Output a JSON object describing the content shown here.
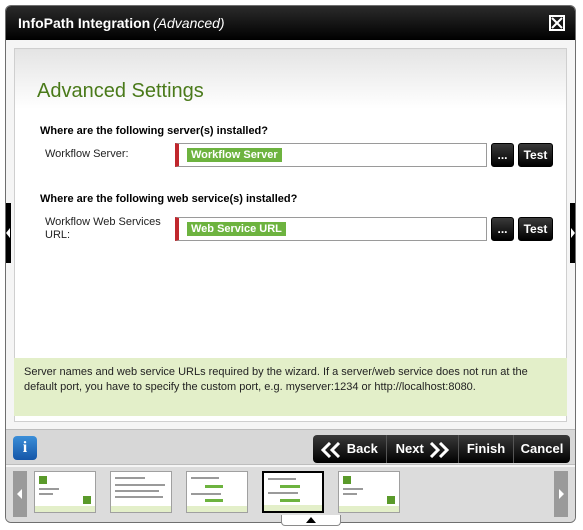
{
  "window": {
    "title": "InfoPath Integration",
    "subtitle": "(Advanced)"
  },
  "page": {
    "title": "Advanced Settings"
  },
  "sections": {
    "server_question": "Where are the following server(s) installed?",
    "server_label": "Workflow Server:",
    "server_value": "Workflow Server",
    "webservice_question": "Where are the following web service(s) installed?",
    "webservice_label": "Workflow Web Services URL:",
    "webservice_value": "Web Service URL",
    "browse_label": "...",
    "test_label": "Test"
  },
  "help": {
    "text": "Server names and web service URLs required by the wizard. If a server/web service does not run at the default port, you have to specify the custom port, e.g. myserver:1234 or http://localhost:8080."
  },
  "nav": {
    "back": "Back",
    "next": "Next",
    "finish": "Finish",
    "cancel": "Cancel",
    "info": "i"
  },
  "colors": {
    "accent_green": "#6db33f",
    "title_green": "#4a7a1a",
    "required_red": "#c0272d",
    "help_bg": "#e3efc9"
  },
  "icons": [
    "close-icon",
    "info-icon",
    "back-chevron-icon",
    "next-chevron-icon",
    "left-arrow-icon",
    "right-arrow-icon",
    "collapse-arrow-icon"
  ]
}
